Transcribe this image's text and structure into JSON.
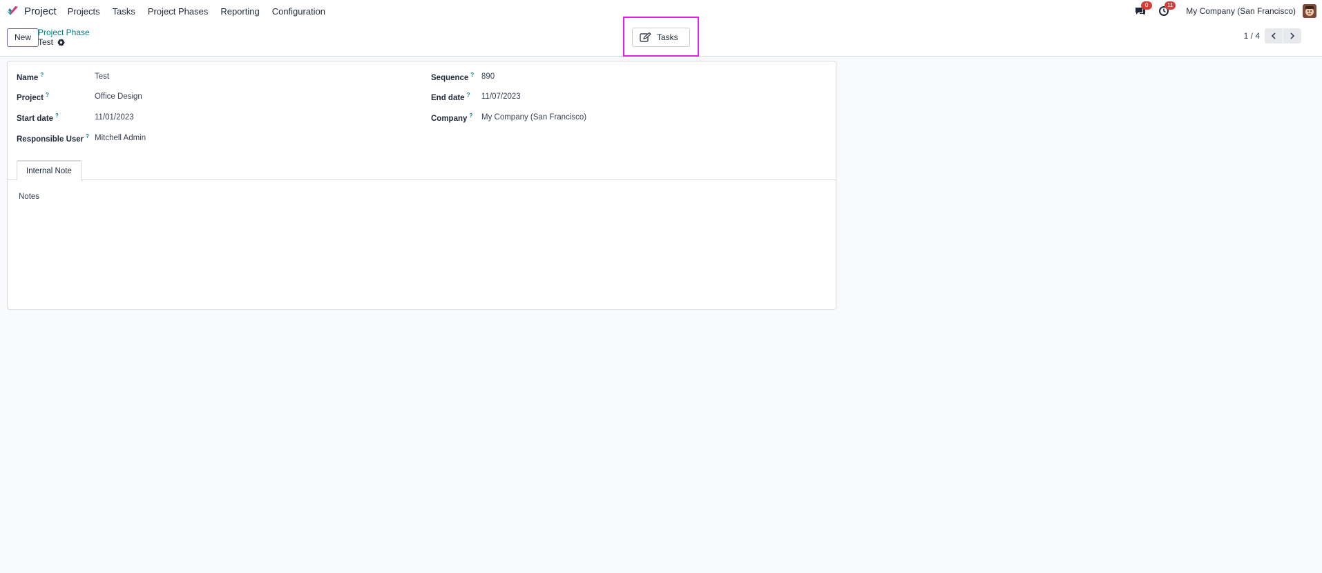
{
  "navbar": {
    "app_name": "Project",
    "menu": [
      "Projects",
      "Tasks",
      "Project Phases",
      "Reporting",
      "Configuration"
    ],
    "messages_badge": "0",
    "activities_badge": "11",
    "company": "My Company (San Francisco)",
    "icons": [
      "project-logo-icon",
      "chat-icon",
      "clock-icon",
      "avatar"
    ]
  },
  "control_panel": {
    "new_label": "New",
    "breadcrumb": "Project Phase",
    "record_title": "Test",
    "smart_button_label": "Tasks",
    "pager_value": "1 / 4"
  },
  "form": {
    "left": [
      {
        "label": "Name",
        "value": "Test"
      },
      {
        "label": "Project",
        "value": "Office Design"
      },
      {
        "label": "Start date",
        "value": "11/01/2023"
      },
      {
        "label": "Responsible User",
        "value": "Mitchell Admin"
      }
    ],
    "right": [
      {
        "label": "Sequence",
        "value": "890"
      },
      {
        "label": "End date",
        "value": "11/07/2023"
      },
      {
        "label": "Company",
        "value": "My Company (San Francisco)"
      }
    ],
    "help_marker": "?",
    "tab_label": "Internal Note",
    "notes_placeholder": "Notes"
  },
  "colors": {
    "accent_teal": "#017e84",
    "primary_purple": "#71639e",
    "highlight": "#e81ee8",
    "badge_red": "#d23f3a"
  }
}
